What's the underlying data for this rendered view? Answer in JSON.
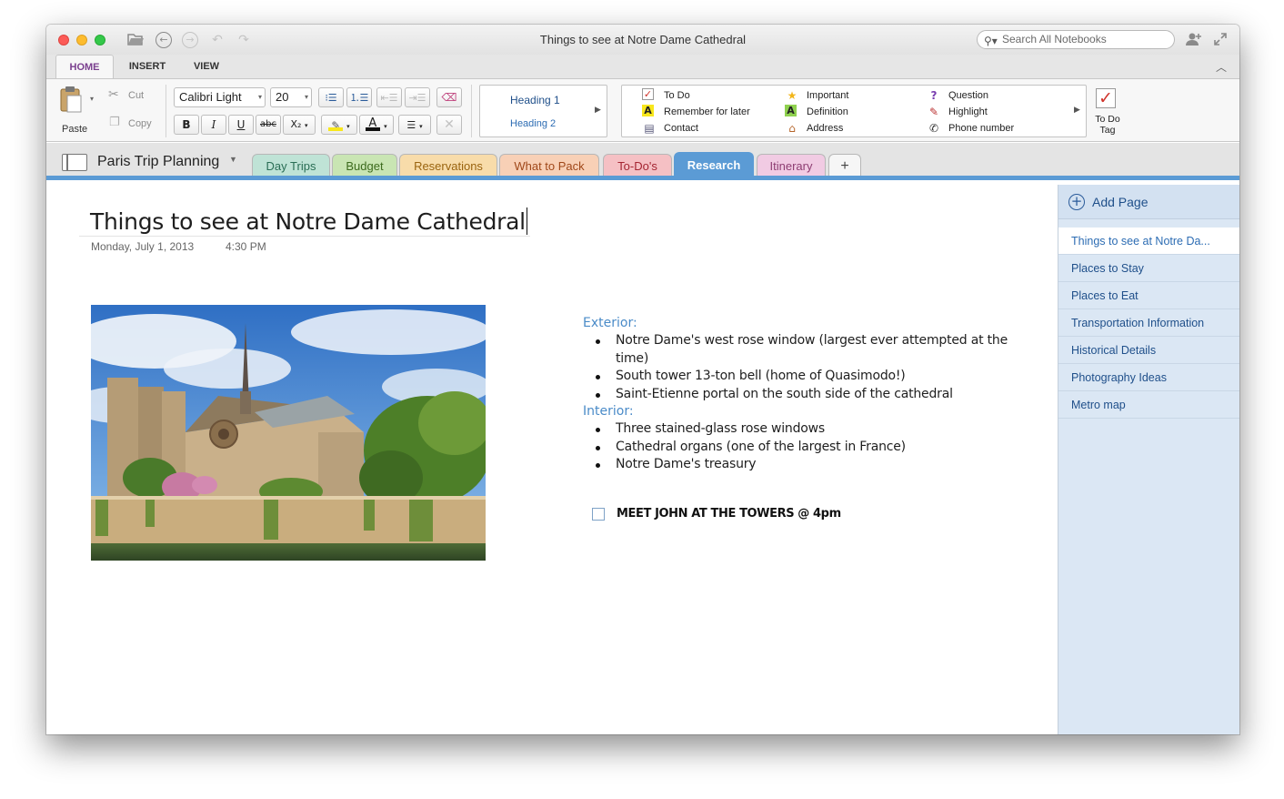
{
  "window": {
    "title": "Things to see at Notre Dame Cathedral",
    "search_placeholder": "Search All Notebooks"
  },
  "ribbon_tabs": [
    "HOME",
    "INSERT",
    "VIEW"
  ],
  "active_ribbon_tab": "HOME",
  "clipboard": {
    "paste": "Paste",
    "cut": "Cut",
    "copy": "Copy"
  },
  "font": {
    "family": "Calibri Light",
    "size": "20",
    "bold": "B",
    "italic": "I",
    "underline": "U",
    "strike": "abc",
    "subscript": "X₂",
    "font_color_letter": "A"
  },
  "styles": {
    "heading1": "Heading 1",
    "heading2": "Heading 2"
  },
  "tags": {
    "col1": [
      "To Do",
      "Remember for later",
      "Contact"
    ],
    "col2": [
      "Important",
      "Definition",
      "Address"
    ],
    "col3": [
      "Question",
      "Highlight",
      "Phone number"
    ],
    "todo_tag_label": "To Do Tag"
  },
  "notebook": {
    "name": "Paris Trip Planning",
    "sections": [
      {
        "label": "Day Trips",
        "color": "#bfe3d6",
        "text": "#2a6e55"
      },
      {
        "label": "Budget",
        "color": "#c9e5b3",
        "text": "#3d6b1e"
      },
      {
        "label": "Reservations",
        "color": "#f8dcaa",
        "text": "#9a6410"
      },
      {
        "label": "What to Pack",
        "color": "#f8d0b6",
        "text": "#a0481a"
      },
      {
        "label": "To-Do's",
        "color": "#f5c0c4",
        "text": "#a42532"
      },
      {
        "label": "Research",
        "color": "#5b9bd5",
        "text": "#ffffff"
      },
      {
        "label": "Itinerary",
        "color": "#f1cbe3",
        "text": "#8e3d72"
      }
    ],
    "active_section": "Research",
    "add_section": "+"
  },
  "page": {
    "title": "Things to see at Notre Dame Cathedral",
    "date": "Monday, July 1, 2013",
    "time": "4:30 PM",
    "exterior_heading": "Exterior:",
    "exterior_items": [
      "Notre Dame's west rose window (largest ever attempted at the time)",
      "South tower 13-ton bell (home of Quasimodo!)",
      "Saint-Etienne portal on the south side of the cathedral"
    ],
    "interior_heading": "Interior:",
    "interior_items": [
      "Three stained-glass rose windows",
      "Cathedral organs (one of the largest in France)",
      "Notre Dame's treasury"
    ],
    "todo": "MEET JOHN AT THE TOWERS @ 4pm"
  },
  "page_list": {
    "add_page": "Add Page",
    "pages": [
      "Things to see at Notre Da...",
      "Places to Stay",
      "Places to Eat",
      "Transportation Information",
      "Historical Details",
      "Photography Ideas",
      "Metro map"
    ],
    "selected_index": 0
  }
}
